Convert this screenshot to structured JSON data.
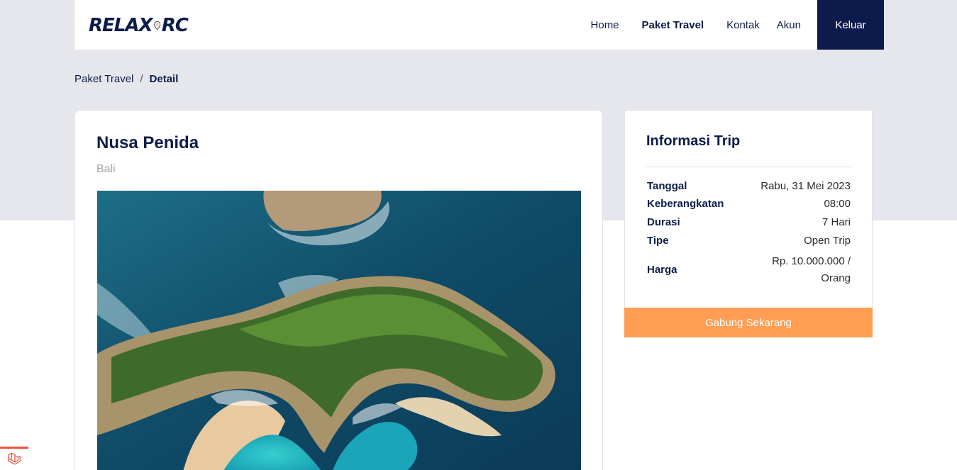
{
  "logo": {
    "left_text": "RELAX",
    "right_text": "RC"
  },
  "nav": {
    "links": [
      {
        "label": "Home"
      },
      {
        "label": "Paket Travel"
      },
      {
        "label": "Kontak"
      },
      {
        "label": "Akun"
      }
    ],
    "logout_label": "Keluar"
  },
  "breadcrumb": {
    "parent": "Paket Travel",
    "separator": "/",
    "current": "Detail"
  },
  "trip": {
    "title": "Nusa Penida",
    "location": "Bali"
  },
  "info": {
    "title": "Informasi Trip",
    "rows": [
      {
        "label": "Tanggal",
        "value": "Rabu, 31 Mei 2023"
      },
      {
        "label": "Keberangkatan",
        "value": "08:00"
      },
      {
        "label": "Durasi",
        "value": "7 Hari"
      },
      {
        "label": "Tipe",
        "value": "Open Trip"
      },
      {
        "label": "Harga",
        "value_line1": "Rp. 10.000.000 /",
        "value_line2": "Orang"
      }
    ],
    "join_label": "Gabung Sekarang"
  },
  "colors": {
    "navy": "#0d1b4c",
    "accent_orange": "#ff9e53",
    "page_bg": "#e6e7ec",
    "laravel_red": "#f05340"
  },
  "icons": {
    "logo_pin": "map-pin-icon",
    "laravel": "laravel-logo-icon"
  }
}
